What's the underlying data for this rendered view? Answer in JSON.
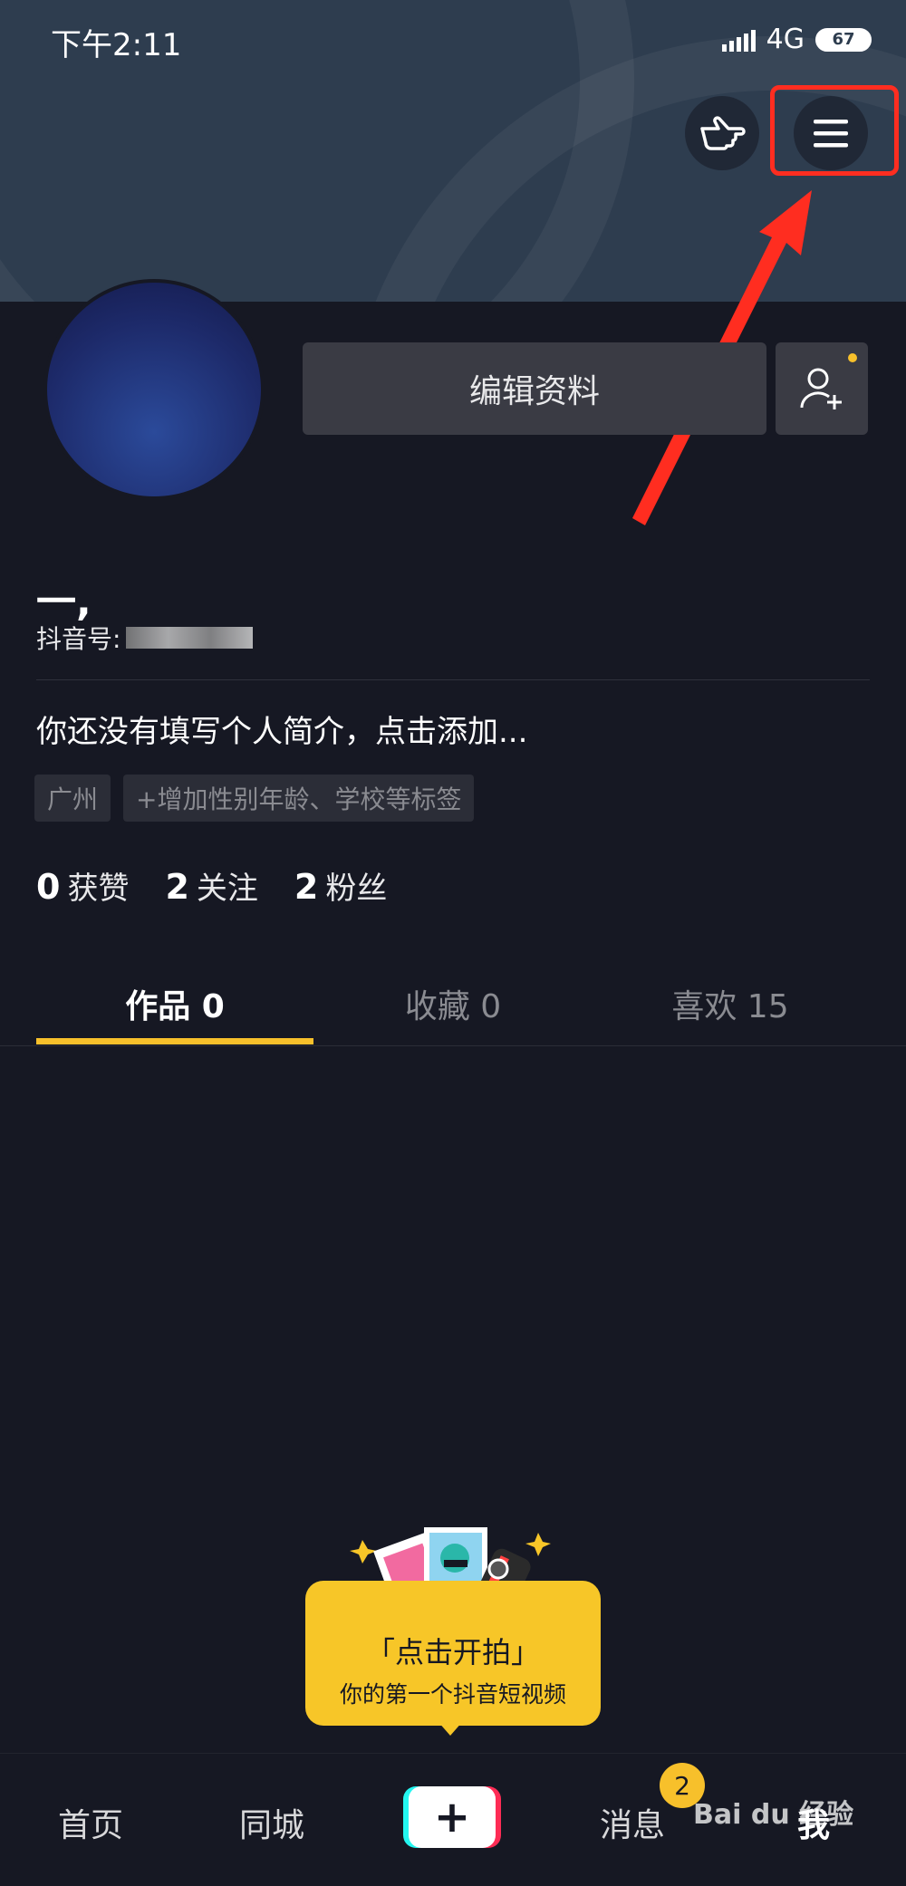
{
  "status_bar": {
    "time": "下午2:11",
    "network": "4G",
    "battery": "67"
  },
  "profile": {
    "username": "一,",
    "douyin_id_label": "抖音号:",
    "edit_button": "编辑资料",
    "bio": "你还没有填写个人简介，点击添加...",
    "tags": [
      "广州",
      "+增加性别年龄、学校等标签"
    ],
    "stats": [
      {
        "value": "0",
        "label": "获赞"
      },
      {
        "value": "2",
        "label": "关注"
      },
      {
        "value": "2",
        "label": "粉丝"
      }
    ]
  },
  "tabs": [
    {
      "label": "作品 0",
      "active": true
    },
    {
      "label": "收藏 0",
      "active": false
    },
    {
      "label": "喜欢 15",
      "active": false
    }
  ],
  "promo": {
    "title": "「点击开拍」",
    "subtitle": "你的第一个抖音短视频"
  },
  "bottom_nav": {
    "items": [
      "首页",
      "同城",
      "消息",
      "我"
    ],
    "plus": "+",
    "message_badge": "2"
  },
  "watermark": "Bai du 经验",
  "icons": {
    "finger": "pointing-hand-icon",
    "menu": "hamburger-menu-icon",
    "add_friend": "add-friend-icon"
  },
  "colors": {
    "accent": "#f7c02b",
    "background": "#161823",
    "annotation": "#ff2d20"
  }
}
